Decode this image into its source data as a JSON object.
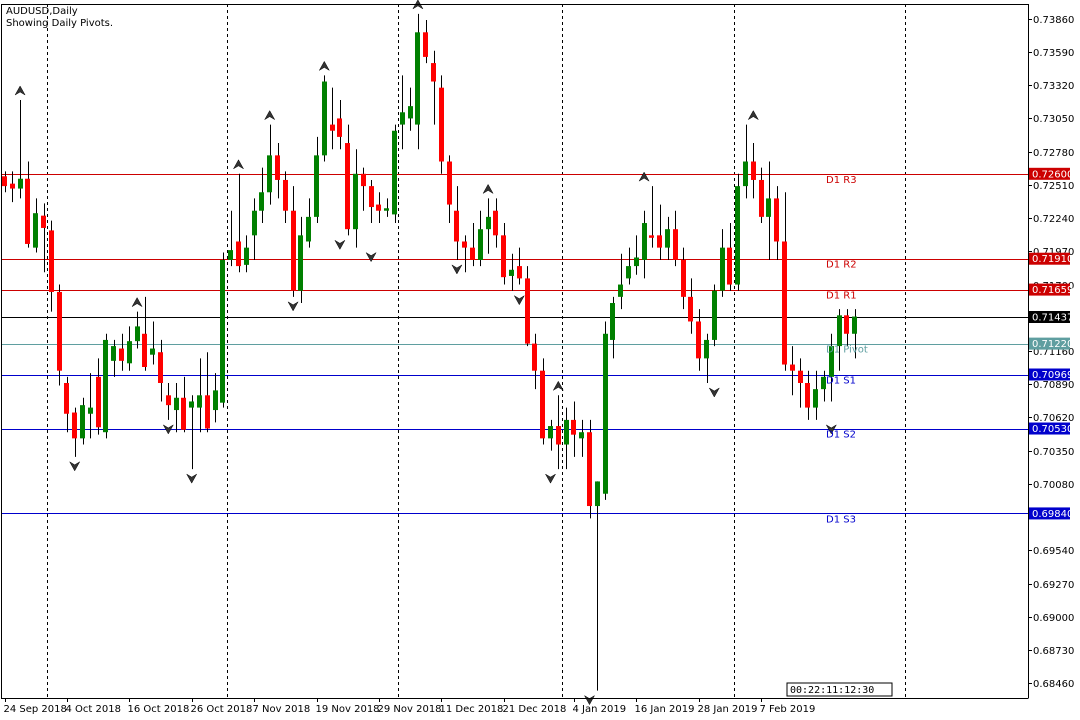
{
  "header": {
    "symbol_line": "AUDUSD,Daily",
    "info_line": "Showing Daily Pivots."
  },
  "timer_text": "00:22:11:12:30",
  "colors": {
    "bull": "#008000",
    "bear": "#ff0000",
    "wick": "#000000",
    "axis": "#000000",
    "grid": "#000000",
    "r_level": "#cc0000",
    "s_level": "#0000cc",
    "pivot": "#5f9ea0",
    "price_line": "#000000"
  },
  "chart_data": {
    "type": "candlestick",
    "title": "AUDUSD,Daily",
    "subtitle": "Showing Daily Pivots.",
    "ylim": [
      0.6834,
      0.7398
    ],
    "y_ticks": [
      "0.73860",
      "0.73590",
      "0.73320",
      "0.73050",
      "0.72780",
      "0.72510",
      "0.72240",
      "0.71970",
      "0.71700",
      "0.71160",
      "0.70890",
      "0.70620",
      "0.70350",
      "0.70080",
      "0.69540",
      "0.69270",
      "0.69000",
      "0.68730",
      "0.68460"
    ],
    "x_ticks": [
      {
        "label": "24 Sep 2018",
        "bar": 0
      },
      {
        "label": "4 Oct 2018",
        "bar": 8
      },
      {
        "label": "16 Oct 2018",
        "bar": 16
      },
      {
        "label": "26 Oct 2018",
        "bar": 24
      },
      {
        "label": "7 Nov 2018",
        "bar": 32
      },
      {
        "label": "19 Nov 2018",
        "bar": 40
      },
      {
        "label": "29 Nov 2018",
        "bar": 48
      },
      {
        "label": "11 Dec 2018",
        "bar": 56
      },
      {
        "label": "21 Dec 2018",
        "bar": 64
      },
      {
        "label": "4 Jan 2019",
        "bar": 73
      },
      {
        "label": "16 Jan 2019",
        "bar": 81
      },
      {
        "label": "28 Jan 2019",
        "bar": 89
      },
      {
        "label": "7 Feb 2019",
        "bar": 97
      }
    ],
    "period_separator_bars": [
      5,
      28,
      50,
      71,
      93,
      115
    ],
    "levels": [
      {
        "name": "D1 R3",
        "value": "0.72600",
        "kind": "r"
      },
      {
        "name": "D1 R2",
        "value": "0.71910",
        "kind": "r"
      },
      {
        "name": "D1 R1",
        "value": "0.71659",
        "kind": "r"
      },
      {
        "name": "D1 Pivot",
        "value": "0.71220",
        "kind": "p"
      },
      {
        "name": "D1 S1",
        "value": "0.70969",
        "kind": "s"
      },
      {
        "name": "D1 S2",
        "value": "0.70530",
        "kind": "s"
      },
      {
        "name": "D1 S3",
        "value": "0.69840",
        "kind": "s"
      }
    ],
    "current_price": "0.71437",
    "candles": [
      [
        0.7258,
        0.7262,
        0.7245,
        0.725
      ],
      [
        0.7252,
        0.7262,
        0.7237,
        0.7248
      ],
      [
        0.7248,
        0.732,
        0.724,
        0.7256
      ],
      [
        0.7256,
        0.727,
        0.72,
        0.7203
      ],
      [
        0.72,
        0.724,
        0.7196,
        0.7228
      ],
      [
        0.7226,
        0.7236,
        0.718,
        0.7216
      ],
      [
        0.7214,
        0.7222,
        0.7148,
        0.7164
      ],
      [
        0.7164,
        0.717,
        0.7088,
        0.71
      ],
      [
        0.709,
        0.7095,
        0.705,
        0.7065
      ],
      [
        0.7066,
        0.707,
        0.703,
        0.7045
      ],
      [
        0.7045,
        0.7078,
        0.704,
        0.7072
      ],
      [
        0.7065,
        0.7098,
        0.7045,
        0.707
      ],
      [
        0.7095,
        0.711,
        0.7048,
        0.7054
      ],
      [
        0.705,
        0.713,
        0.7045,
        0.7125
      ],
      [
        0.7108,
        0.7125,
        0.7095,
        0.712
      ],
      [
        0.7118,
        0.713,
        0.71,
        0.7108
      ],
      [
        0.7106,
        0.7136,
        0.71,
        0.7124
      ],
      [
        0.7124,
        0.7148,
        0.7118,
        0.7136
      ],
      [
        0.713,
        0.716,
        0.71,
        0.7103
      ],
      [
        0.7113,
        0.714,
        0.7105,
        0.7118
      ],
      [
        0.7115,
        0.7125,
        0.7075,
        0.709
      ],
      [
        0.708,
        0.709,
        0.706,
        0.7072
      ],
      [
        0.7068,
        0.709,
        0.705,
        0.7078
      ],
      [
        0.7078,
        0.7095,
        0.705,
        0.7052
      ],
      [
        0.707,
        0.708,
        0.702,
        0.7075
      ],
      [
        0.707,
        0.711,
        0.705,
        0.708
      ],
      [
        0.708,
        0.7115,
        0.705,
        0.7053
      ],
      [
        0.7068,
        0.7098,
        0.7058,
        0.7084
      ],
      [
        0.7074,
        0.7196,
        0.707,
        0.719
      ],
      [
        0.719,
        0.723,
        0.7185,
        0.7198
      ],
      [
        0.7205,
        0.726,
        0.718,
        0.7185
      ],
      [
        0.7186,
        0.721,
        0.718,
        0.72
      ],
      [
        0.721,
        0.724,
        0.719,
        0.723
      ],
      [
        0.723,
        0.7265,
        0.722,
        0.7245
      ],
      [
        0.7245,
        0.73,
        0.7235,
        0.7275
      ],
      [
        0.7275,
        0.7285,
        0.724,
        0.7255
      ],
      [
        0.7255,
        0.7262,
        0.722,
        0.723
      ],
      [
        0.723,
        0.725,
        0.716,
        0.7165
      ],
      [
        0.7165,
        0.7225,
        0.7155,
        0.721
      ],
      [
        0.7205,
        0.724,
        0.72,
        0.7225
      ],
      [
        0.7225,
        0.729,
        0.722,
        0.7275
      ],
      [
        0.7275,
        0.734,
        0.727,
        0.7335
      ],
      [
        0.73,
        0.733,
        0.728,
        0.7295
      ],
      [
        0.7305,
        0.732,
        0.728,
        0.729
      ],
      [
        0.7285,
        0.73,
        0.721,
        0.7215
      ],
      [
        0.7215,
        0.728,
        0.72,
        0.726
      ],
      [
        0.726,
        0.7265,
        0.723,
        0.725
      ],
      [
        0.725,
        0.7255,
        0.722,
        0.7233
      ],
      [
        0.7235,
        0.7245,
        0.722,
        0.723
      ],
      [
        0.723,
        0.724,
        0.7225,
        0.7232
      ],
      [
        0.7227,
        0.73,
        0.722,
        0.7295
      ],
      [
        0.73,
        0.734,
        0.728,
        0.731
      ],
      [
        0.7305,
        0.733,
        0.7295,
        0.7315
      ],
      [
        0.73,
        0.739,
        0.728,
        0.7375
      ],
      [
        0.7375,
        0.7385,
        0.735,
        0.7355
      ],
      [
        0.735,
        0.736,
        0.73,
        0.7335
      ],
      [
        0.733,
        0.734,
        0.726,
        0.727
      ],
      [
        0.727,
        0.7275,
        0.722,
        0.7235
      ],
      [
        0.723,
        0.725,
        0.719,
        0.7205
      ],
      [
        0.7205,
        0.721,
        0.718,
        0.72
      ],
      [
        0.72,
        0.722,
        0.7185,
        0.719
      ],
      [
        0.719,
        0.723,
        0.7185,
        0.7215
      ],
      [
        0.7215,
        0.724,
        0.7195,
        0.7225
      ],
      [
        0.723,
        0.724,
        0.72,
        0.721
      ],
      [
        0.721,
        0.722,
        0.717,
        0.7176
      ],
      [
        0.7177,
        0.7195,
        0.7165,
        0.7182
      ],
      [
        0.7185,
        0.72,
        0.717,
        0.7175
      ],
      [
        0.7175,
        0.7185,
        0.712,
        0.7122
      ],
      [
        0.7122,
        0.713,
        0.7085,
        0.71
      ],
      [
        0.71,
        0.711,
        0.704,
        0.7045
      ],
      [
        0.7045,
        0.706,
        0.7035,
        0.7055
      ],
      [
        0.7055,
        0.708,
        0.702,
        0.704
      ],
      [
        0.704,
        0.707,
        0.702,
        0.706
      ],
      [
        0.706,
        0.7075,
        0.703,
        0.7048
      ],
      [
        0.7045,
        0.706,
        0.703,
        0.705
      ],
      [
        0.705,
        0.706,
        0.698,
        0.699
      ],
      [
        0.699,
        0.701,
        0.684,
        0.701
      ],
      [
        0.7,
        0.714,
        0.6995,
        0.713
      ],
      [
        0.7125,
        0.716,
        0.711,
        0.7155
      ],
      [
        0.716,
        0.7195,
        0.715,
        0.717
      ],
      [
        0.7175,
        0.72,
        0.717,
        0.7185
      ],
      [
        0.7185,
        0.721,
        0.7178,
        0.7192
      ],
      [
        0.719,
        0.723,
        0.7175,
        0.722
      ],
      [
        0.721,
        0.725,
        0.72,
        0.7208
      ],
      [
        0.721,
        0.7235,
        0.719,
        0.72
      ],
      [
        0.72,
        0.7225,
        0.719,
        0.7215
      ],
      [
        0.7215,
        0.723,
        0.7185,
        0.719
      ],
      [
        0.719,
        0.72,
        0.715,
        0.716
      ],
      [
        0.716,
        0.7175,
        0.713,
        0.714
      ],
      [
        0.714,
        0.715,
        0.71,
        0.711
      ],
      [
        0.711,
        0.713,
        0.709,
        0.7125
      ],
      [
        0.7125,
        0.717,
        0.712,
        0.7165
      ],
      [
        0.7165,
        0.7215,
        0.716,
        0.72
      ],
      [
        0.72,
        0.722,
        0.7165,
        0.717
      ],
      [
        0.717,
        0.726,
        0.7165,
        0.725
      ],
      [
        0.725,
        0.73,
        0.724,
        0.727
      ],
      [
        0.727,
        0.7285,
        0.724,
        0.7255
      ],
      [
        0.7255,
        0.7265,
        0.722,
        0.7225
      ],
      [
        0.7225,
        0.727,
        0.719,
        0.724
      ],
      [
        0.724,
        0.725,
        0.719,
        0.7205
      ],
      [
        0.7205,
        0.7245,
        0.71,
        0.7105
      ],
      [
        0.7105,
        0.712,
        0.708,
        0.71
      ],
      [
        0.71,
        0.711,
        0.707,
        0.709
      ],
      [
        0.709,
        0.71,
        0.706,
        0.707
      ],
      [
        0.707,
        0.71,
        0.706,
        0.7085
      ],
      [
        0.7085,
        0.71,
        0.7075,
        0.7095
      ],
      [
        0.7095,
        0.713,
        0.7075,
        0.712
      ],
      [
        0.712,
        0.715,
        0.71,
        0.7145
      ],
      [
        0.7145,
        0.715,
        0.712,
        0.713
      ],
      [
        0.713,
        0.715,
        0.711,
        0.7144
      ]
    ],
    "fractals": [
      {
        "bar": 2,
        "dir": "up",
        "value": 0.732
      },
      {
        "bar": 9,
        "dir": "down",
        "value": 0.703
      },
      {
        "bar": 17,
        "dir": "up",
        "value": 0.7148
      },
      {
        "bar": 21,
        "dir": "down",
        "value": 0.706
      },
      {
        "bar": 24,
        "dir": "down",
        "value": 0.702
      },
      {
        "bar": 30,
        "dir": "up",
        "value": 0.726
      },
      {
        "bar": 34,
        "dir": "up",
        "value": 0.73
      },
      {
        "bar": 37,
        "dir": "down",
        "value": 0.716
      },
      {
        "bar": 41,
        "dir": "up",
        "value": 0.734
      },
      {
        "bar": 43,
        "dir": "down",
        "value": 0.721
      },
      {
        "bar": 47,
        "dir": "down",
        "value": 0.72
      },
      {
        "bar": 53,
        "dir": "up",
        "value": 0.739
      },
      {
        "bar": 58,
        "dir": "down",
        "value": 0.719
      },
      {
        "bar": 62,
        "dir": "up",
        "value": 0.724
      },
      {
        "bar": 66,
        "dir": "down",
        "value": 0.7165
      },
      {
        "bar": 71,
        "dir": "up",
        "value": 0.708
      },
      {
        "bar": 70,
        "dir": "down",
        "value": 0.702
      },
      {
        "bar": 75,
        "dir": "down",
        "value": 0.684
      },
      {
        "bar": 82,
        "dir": "up",
        "value": 0.725
      },
      {
        "bar": 91,
        "dir": "down",
        "value": 0.709
      },
      {
        "bar": 96,
        "dir": "up",
        "value": 0.73
      },
      {
        "bar": 106,
        "dir": "down",
        "value": 0.706
      }
    ]
  }
}
